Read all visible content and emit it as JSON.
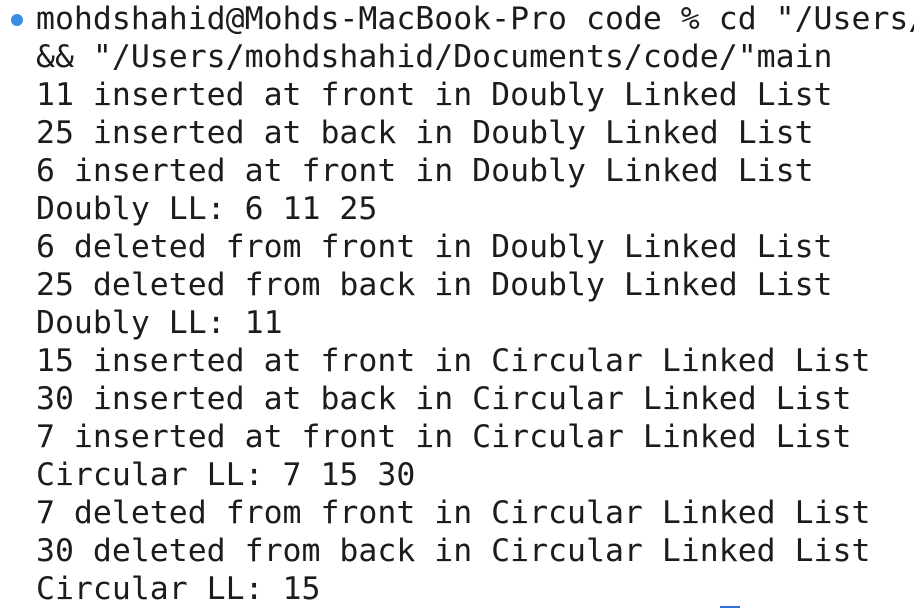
{
  "terminal": {
    "status_color": "#3a8ee6",
    "command_lines": [
      "mohdshahid@Mohds-MacBook-Pro code % cd \"/Users/",
      "&& \"/Users/mohdshahid/Documents/code/\"main"
    ],
    "output_lines": [
      "11 inserted at front in Doubly Linked List",
      "25 inserted at back in Doubly Linked List",
      "6 inserted at front in Doubly Linked List",
      "Doubly LL: 6 11 25",
      "6 deleted from front in Doubly Linked List",
      "25 deleted from back in Doubly Linked List",
      "Doubly LL: 11",
      "15 inserted at front in Circular Linked List",
      "30 inserted at back in Circular Linked List",
      "7 inserted at front in Circular Linked List",
      "Circular LL: 7 15 30",
      "7 deleted from front in Circular Linked List",
      "30 deleted from back in Circular Linked List",
      "Circular LL: 15"
    ]
  }
}
